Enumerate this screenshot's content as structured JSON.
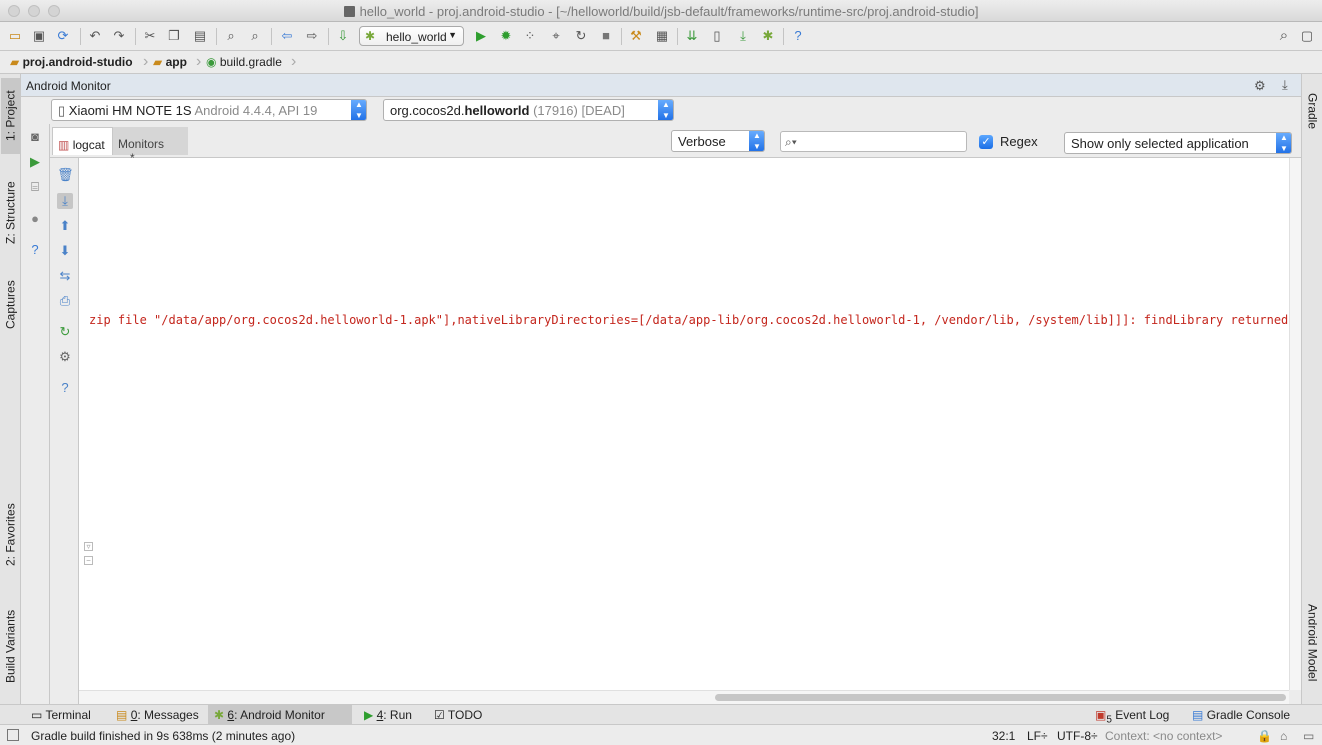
{
  "window": {
    "title": "hello_world - proj.android-studio - [~/helloworld/build/jsb-default/frameworks/runtime-src/proj.android-studio]"
  },
  "toolbar": {
    "run_config": "hello_world"
  },
  "breadcrumb": {
    "items": [
      "proj.android-studio",
      "app",
      "build.gradle"
    ]
  },
  "left_stripe": {
    "project": "1: Project",
    "structure": "Z: Structure",
    "captures": "Captures",
    "favorites": "2: Favorites",
    "build_variants": "Build Variants"
  },
  "right_stripe": {
    "gradle": "Gradle",
    "android_model": "Android Model"
  },
  "monitor": {
    "title": "Android Monitor",
    "device_name": "Xiaomi HM NOTE 1S",
    "device_info": "Android 4.4.4, API 19",
    "process_prefix": "org.cocos2d.",
    "process_bold": "helloworld",
    "process_suffix": "(17916) [DEAD]"
  },
  "tabs": {
    "logcat": "logcat",
    "monitors": "Monitors",
    "monitors_suffix": "→*"
  },
  "filters": {
    "log_level": "Verbose",
    "search_value": "",
    "regex_label": "Regex",
    "regex_checked": true,
    "app_filter": "Show only selected application"
  },
  "log": {
    "line": "zip file \"/data/app/org.cocos2d.helloworld-1.apk\"],nativeLibraryDirectories=[/data/app-lib/org.cocos2d.helloworld-1, /vendor/lib, /system/lib]]]: findLibrary returned null"
  },
  "bottom_tabs": {
    "terminal": "Terminal",
    "messages_num": "0",
    "messages": ": Messages",
    "monitor_num": "6",
    "monitor": ": Android Monitor",
    "run_num": "4",
    "run": ": Run",
    "todo": "TODO",
    "event_log_badge": "5",
    "event_log": "Event Log",
    "gradle_console": "Gradle Console"
  },
  "status": {
    "message": "Gradle build finished in 9s 638ms (2 minutes ago)",
    "position": "32:1",
    "line_sep": "LF÷",
    "encoding": "UTF-8÷",
    "context": "Context: <no context>"
  },
  "colors": {
    "log_error": "#c4261d",
    "accent_blue": "#1f6fe6",
    "tool_header": "#dfe6ee"
  }
}
